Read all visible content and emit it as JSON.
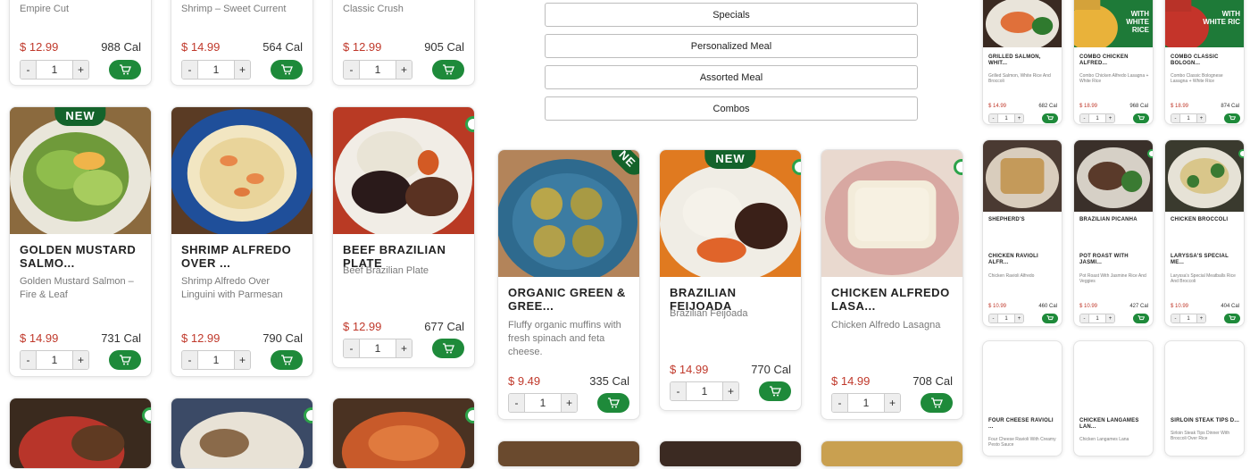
{
  "filters": [
    "Specials",
    "Personalized Meal",
    "Assorted Meal",
    "Combos"
  ],
  "top_row": [
    {
      "title": "Empire Cut",
      "price": "$ 12.99",
      "cal": "988 Cal",
      "qty": "1"
    },
    {
      "title": "Shrimp – Sweet Current",
      "price": "$ 14.99",
      "cal": "564 Cal",
      "qty": "1"
    },
    {
      "title": "Classic Crush",
      "price": "$ 12.99",
      "cal": "905 Cal",
      "qty": "1"
    }
  ],
  "left_cards": [
    {
      "badge": "NEW",
      "title": "GOLDEN MUSTARD SALMO...",
      "desc": "Golden Mustard Salmon – Fire & Leaf",
      "price": "$ 14.99",
      "cal": "731 Cal",
      "qty": "1"
    },
    {
      "badge": "",
      "title": "SHRIMP ALFREDO OVER ...",
      "desc": "Shrimp Alfredo Over Linguini with Parmesan",
      "price": "$ 12.99",
      "cal": "790 Cal",
      "qty": "1"
    },
    {
      "badge": "",
      "title": "BEEF BRAZILIAN PLATE",
      "desc": "Beef Brazilian Plate",
      "price": "$ 12.99",
      "cal": "677 Cal",
      "qty": "1"
    }
  ],
  "mid_cards": [
    {
      "badge": "NE",
      "title": "ORGANIC GREEN & GREE...",
      "desc": "Fluffy organic muffins with fresh spinach and feta cheese.",
      "price": "$ 9.49",
      "cal": "335 Cal",
      "qty": "1"
    },
    {
      "badge": "NEW",
      "title": "BRAZILIAN FEIJOADA",
      "desc": "Brazilian Feijoada",
      "price": "$ 14.99",
      "cal": "770 Cal",
      "qty": "1"
    },
    {
      "badge": "",
      "title": "CHICKEN ALFREDO LASA...",
      "desc": "Chicken Alfredo Lasagna",
      "price": "$ 14.99",
      "cal": "708 Cal",
      "qty": "1"
    }
  ],
  "mini_row1": [
    {
      "title": "GRILLED SALMON, WHIT...",
      "desc": "Grilled Salmon, White Rice And Broccoli",
      "price": "$ 14.99",
      "cal": "682 Cal",
      "qty": "1",
      "overlay": ""
    },
    {
      "title": "COMBO CHICKEN ALFRED...",
      "desc": "Combo Chicken Alfredo Lasagna + White Rice",
      "price": "$ 18.99",
      "cal": "968 Cal",
      "qty": "1",
      "overlay": "WITH WHITE RICE"
    },
    {
      "title": "COMBO CLASSIC BOLOGN...",
      "desc": "Combo Classic Bolognese Lasagna + White Rice",
      "price": "$ 18.99",
      "cal": "874 Cal",
      "qty": "1",
      "overlay": "WITH WHITE RIC"
    }
  ],
  "mini_row2": [
    {
      "label": "SHEPHERD'S",
      "title": "CHICKEN RAVIOLI ALFR...",
      "desc": "Chicken Ravioli Alfredo",
      "price": "$ 10.99",
      "cal": "460 Cal",
      "qty": "1"
    },
    {
      "label": "BRAZILIAN PICANHA",
      "title": "POT ROAST WITH JASMI...",
      "desc": "Pot Roast With Jasmine Rice And Veggies",
      "price": "$ 10.99",
      "cal": "427 Cal",
      "qty": "1"
    },
    {
      "label": "CHICKEN BROCCOLI",
      "title": "LARYSSA'S SPECIAL ME...",
      "desc": "Laryssa's Special Meatballs Rice And Broccoli",
      "price": "$ 10.99",
      "cal": "404 Cal",
      "qty": "1"
    }
  ],
  "mini_row3": [
    {
      "title": "FOUR CHEESE RAVIOLI ...",
      "desc": "Four Cheese Ravioli With Creamy Pesto Sauce"
    },
    {
      "title": "CHICKEN LANGAMES LAN...",
      "desc": "Chicken Langames Lana"
    },
    {
      "title": "SIRLOIN STEAK TIPS D...",
      "desc": "Sirloin Steak Tips Dinner With Broccoli Over Rice"
    }
  ],
  "plus": "+",
  "minus": "-",
  "colors": {
    "accent_green": "#1e8a3a",
    "price_red": "#c0392b",
    "badge_green": "#14632b"
  }
}
